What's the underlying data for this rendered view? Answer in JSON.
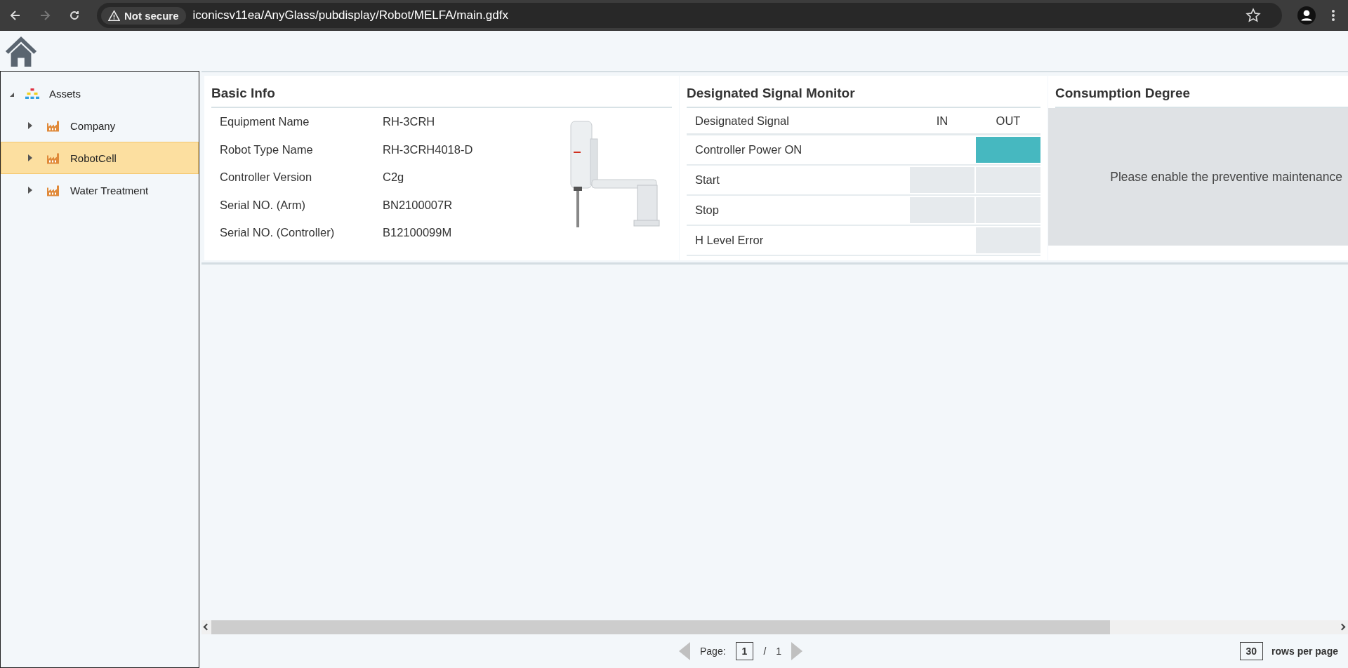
{
  "browser": {
    "security_label": "Not secure",
    "url": "iconicsv11ea/AnyGlass/pubdisplay/Robot/MELFA/main.gdfx"
  },
  "tree": [
    {
      "label": "Assets",
      "kind": "root",
      "expanded": true,
      "selected": false,
      "children": [
        {
          "label": "Company",
          "kind": "site",
          "expanded": false,
          "selected": false
        },
        {
          "label": "RobotCell",
          "kind": "site",
          "expanded": false,
          "selected": true
        },
        {
          "label": "Water Treatment",
          "kind": "site",
          "expanded": false,
          "selected": false
        }
      ]
    }
  ],
  "basic_info": {
    "title": "Basic Info",
    "rows": [
      {
        "label": "Equipment Name",
        "value": "RH-3CRH"
      },
      {
        "label": "Robot Type Name",
        "value": "RH-3CRH4018-D"
      },
      {
        "label": "Controller Version",
        "value": "C2g"
      },
      {
        "label": "Serial NO. (Arm)",
        "value": "BN2100007R"
      },
      {
        "label": "Serial NO. (Controller)",
        "value": "B12100099M"
      }
    ]
  },
  "signal_monitor": {
    "title": "Designated Signal Monitor",
    "columns": [
      "Designated Signal",
      "IN",
      "OUT"
    ],
    "rows": [
      {
        "signal": "Controller Power ON",
        "out_on": true
      },
      {
        "signal": "Start",
        "in_on": false,
        "out_on": false
      },
      {
        "signal": "Stop",
        "in_on": false,
        "out_on": false
      },
      {
        "signal": "H Level Error",
        "out_on": false
      }
    ]
  },
  "consumption": {
    "title": "Consumption Degree",
    "message": "Please enable the preventive maintenance"
  },
  "pager": {
    "page_label": "Page:",
    "page": "1",
    "separator": "/",
    "total": "1",
    "rows": "30",
    "rows_label": "rows per page"
  }
}
